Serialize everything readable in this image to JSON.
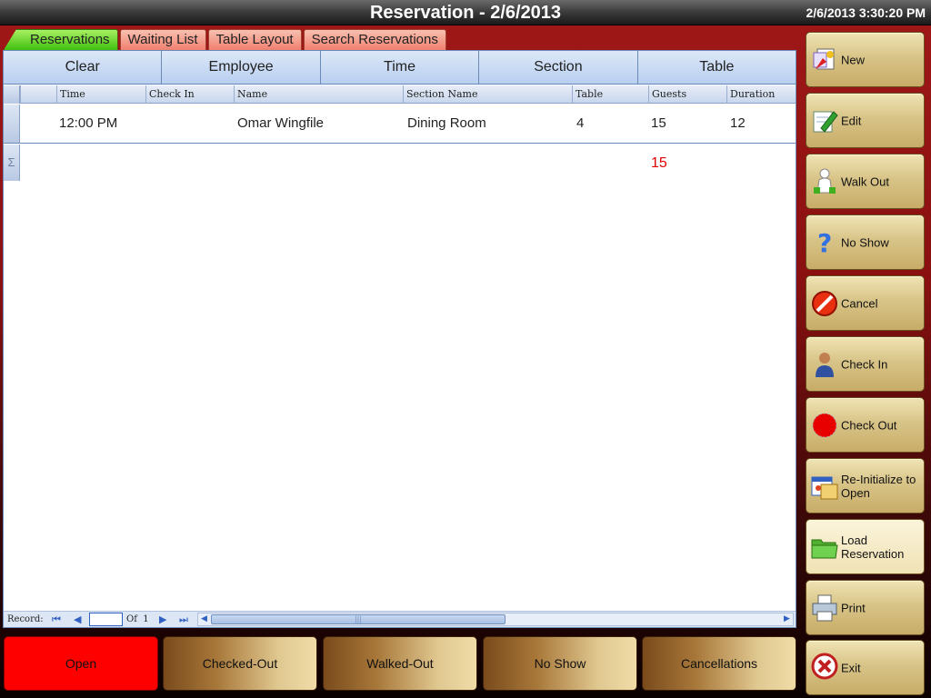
{
  "window": {
    "title": "Reservation - 2/6/2013",
    "clock": "2/6/2013 3:30:20 PM"
  },
  "tabs": [
    {
      "label": "Reservations",
      "active": true
    },
    {
      "label": "Waiting List"
    },
    {
      "label": "Table Layout"
    },
    {
      "label": "Search Reservations"
    }
  ],
  "filters": [
    "Clear",
    "Employee",
    "Time",
    "Section",
    "Table"
  ],
  "grid": {
    "columns": [
      "Time",
      "Check In",
      "Name",
      "Section Name",
      "Table",
      "Guests",
      "Duration"
    ],
    "rows": [
      {
        "time": "12:00 PM",
        "check_in": "",
        "name": "Omar Wingfile",
        "section": "Dining Room",
        "table": "4",
        "guests": "15",
        "duration": "12"
      }
    ],
    "summary_symbol": "Σ",
    "guests_total": "15"
  },
  "navigator": {
    "record_label": "Record:",
    "of_label": "Of",
    "total": "1",
    "current": ""
  },
  "actions": [
    {
      "label": "New",
      "icon": "new-document-icon"
    },
    {
      "label": "Edit",
      "icon": "edit-pencil-icon"
    },
    {
      "label": "Walk Out",
      "icon": "walk-out-person-icon"
    },
    {
      "label": "No Show",
      "icon": "question-mark-icon"
    },
    {
      "label": "Cancel",
      "icon": "cancel-circle-icon"
    },
    {
      "label": "Check In",
      "icon": "check-in-person-icon"
    },
    {
      "label": "Check Out",
      "icon": "red-dot-icon"
    },
    {
      "label": "Re-Initialize to Open",
      "icon": "reinitialize-icon"
    },
    {
      "label": "Load Reservation",
      "icon": "folder-icon"
    },
    {
      "label": "Print",
      "icon": "printer-icon"
    },
    {
      "label": "Exit",
      "icon": "exit-x-icon"
    }
  ],
  "status_buttons": [
    "Open",
    "Checked-Out",
    "Walked-Out",
    "No Show",
    "Cancellations"
  ],
  "colors": {
    "open_status": "#ff0000",
    "guests_total": "#e00000",
    "active_tab": "#40c010"
  }
}
